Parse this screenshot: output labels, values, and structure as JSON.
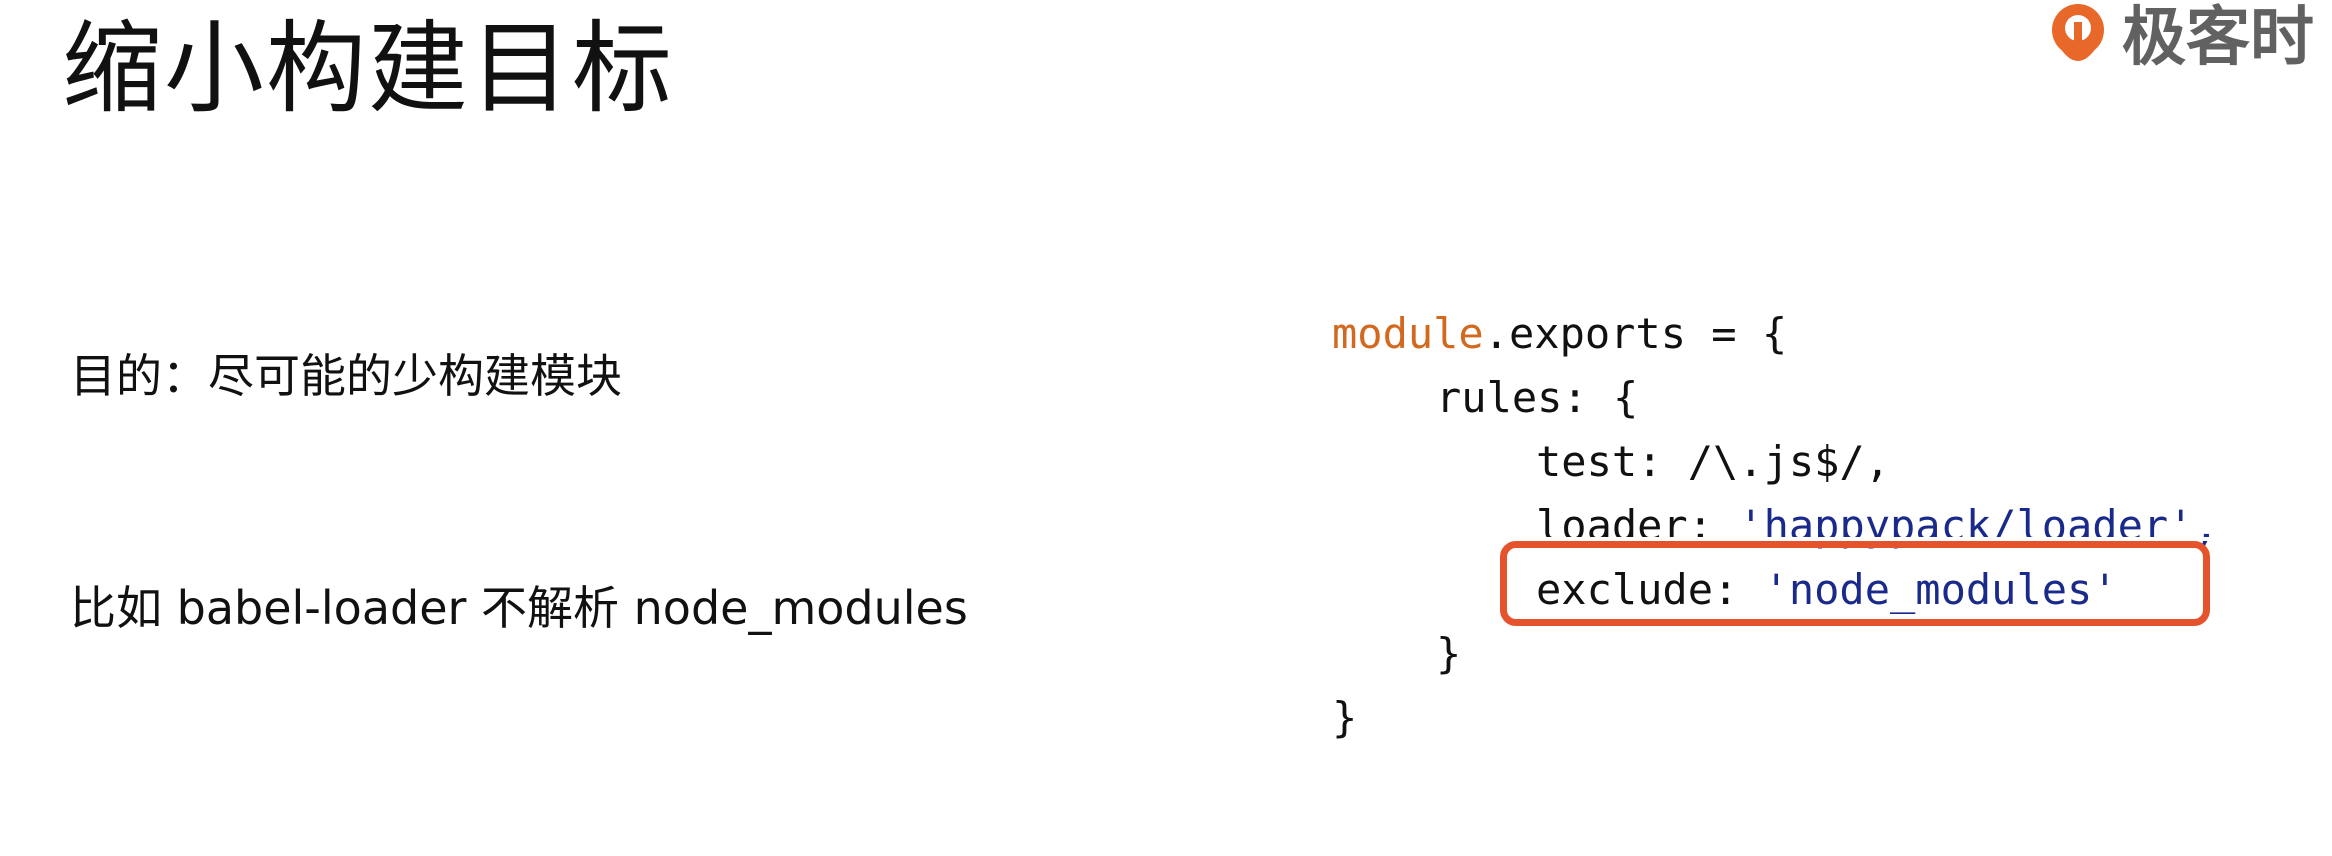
{
  "slide": {
    "title": "缩小构建目标"
  },
  "brand": {
    "name": "极客时",
    "accent": "#e8682a",
    "text_color": "#616161"
  },
  "bullets": [
    "目的：尽可能的少构建模块",
    "比如 babel-loader 不解析 node_modules"
  ],
  "code": {
    "line1_kw": "module",
    "line1_rest": ".exports = {",
    "line2": "rules: {",
    "line3": "test: /\\.js$/,",
    "line4_key": "loader: ",
    "line4_val": "'happypack/loader',",
    "line5_key": "exclude: ",
    "line5_val": "'node_modules'",
    "line6": "}",
    "line7": "}",
    "highlight_color": "#e5532d",
    "keyword_color": "#d2691e",
    "string_color": "#1a2a8a"
  }
}
